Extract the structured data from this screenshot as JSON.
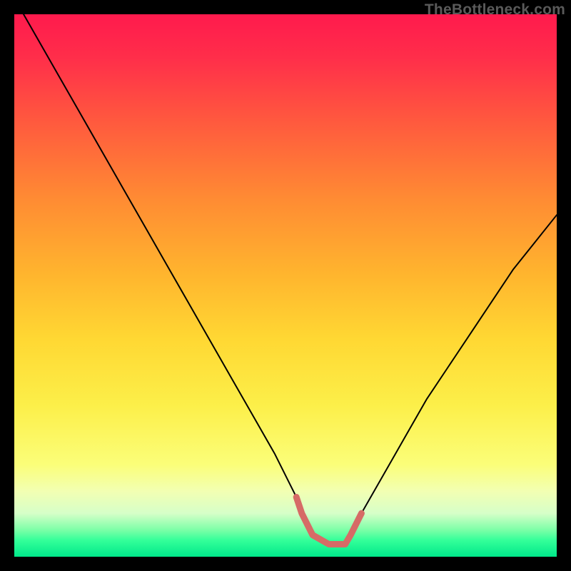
{
  "watermark": "TheBottleneck.com",
  "colors": {
    "frame": "#000000",
    "curve_stroke": "#000000",
    "accent_stroke": "#d66b66",
    "gradient_top": "#ff1a4d",
    "gradient_bottom": "#00e88a"
  },
  "chart_data": {
    "type": "line",
    "title": "",
    "xlabel": "",
    "ylabel": "",
    "xlim": [
      0,
      100
    ],
    "ylim": [
      0,
      100
    ],
    "grid": false,
    "series": [
      {
        "name": "bottleneck-curve",
        "x": [
          0,
          4,
          8,
          12,
          16,
          20,
          24,
          28,
          32,
          36,
          40,
          44,
          48,
          52,
          53,
          55,
          58,
          61,
          62,
          64,
          68,
          72,
          76,
          80,
          84,
          88,
          92,
          96,
          100
        ],
        "values": [
          103,
          96,
          89,
          82,
          75,
          68,
          61,
          54,
          47,
          40,
          33,
          26,
          19,
          11,
          8,
          4,
          2.3,
          2.3,
          4,
          8,
          15,
          22,
          29,
          35,
          41,
          47,
          53,
          58,
          63
        ]
      },
      {
        "name": "accent-segment",
        "x": [
          52,
          53,
          55,
          58,
          61,
          62,
          64
        ],
        "values": [
          11,
          8,
          4,
          2.3,
          2.3,
          4,
          8
        ]
      }
    ]
  }
}
